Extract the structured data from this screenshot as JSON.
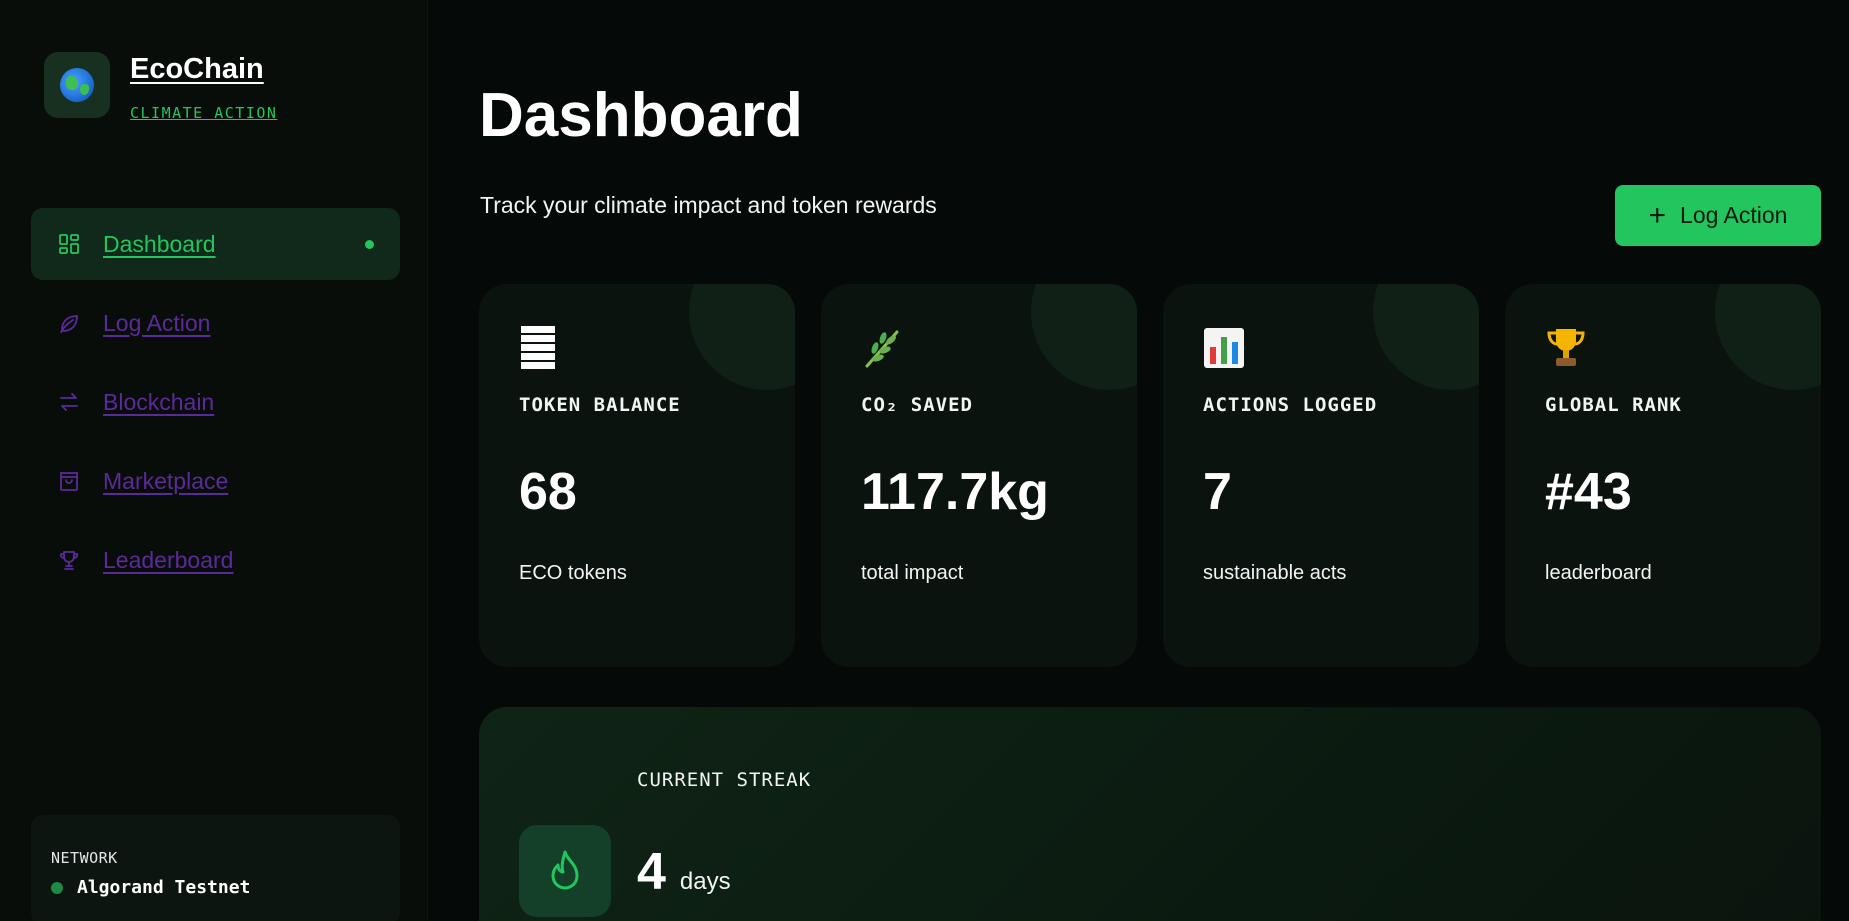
{
  "brand": {
    "name": "EcoChain",
    "tagline": "CLIMATE ACTION"
  },
  "sidebar": {
    "items": [
      {
        "label": "Dashboard",
        "icon": "grid-icon",
        "active": true
      },
      {
        "label": "Log Action",
        "icon": "leaf-icon"
      },
      {
        "label": "Blockchain",
        "icon": "arrows-swap-icon"
      },
      {
        "label": "Marketplace",
        "icon": "shopping-bag-icon"
      },
      {
        "label": "Leaderboard",
        "icon": "trophy-icon"
      }
    ],
    "network": {
      "title": "NETWORK",
      "name": "Algorand Testnet",
      "status_color": "#1f8a45"
    }
  },
  "header": {
    "title": "Dashboard",
    "subtitle": "Track your climate impact and token rewards",
    "action_button": {
      "label": "Log Action",
      "icon": "plus-icon"
    }
  },
  "stats": [
    {
      "label": "TOKEN BALANCE",
      "value": "68",
      "sub": "ECO tokens",
      "icon": "token-stack-icon"
    },
    {
      "label": "CO₂ SAVED",
      "value": "117.7kg",
      "sub": "total impact",
      "icon": "herb-icon"
    },
    {
      "label": "ACTIONS LOGGED",
      "value": "7",
      "sub": "sustainable acts",
      "icon": "bar-chart-icon"
    },
    {
      "label": "GLOBAL RANK",
      "value": "#43",
      "sub": "leaderboard",
      "icon": "trophy-icon"
    }
  ],
  "streak": {
    "label": "CURRENT STREAK",
    "value": "4",
    "unit": "days",
    "icon": "flame-icon"
  },
  "colors": {
    "accent": "#22c55e",
    "nav_link": "#5b2a9a",
    "background": "#050907",
    "card": "#0b130e"
  }
}
